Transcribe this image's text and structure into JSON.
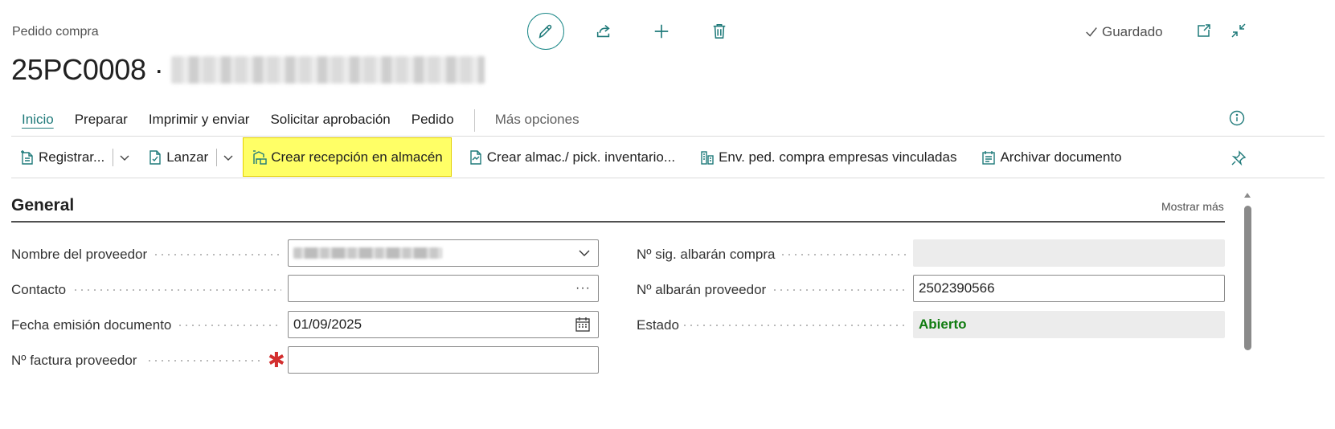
{
  "header": {
    "caption": "Pedido compra",
    "record_no": "25PC0008",
    "separator": "·",
    "saved_label": "Guardado"
  },
  "top_actions": {
    "edit_icon": "pencil-icon",
    "share_icon": "share-icon",
    "new_icon": "plus-icon",
    "delete_icon": "trash-icon"
  },
  "tabs": [
    {
      "label": "Inicio",
      "active": true
    },
    {
      "label": "Preparar"
    },
    {
      "label": "Imprimir y enviar"
    },
    {
      "label": "Solicitar aprobación"
    },
    {
      "label": "Pedido"
    },
    {
      "label": "Más opciones"
    }
  ],
  "toolbar": {
    "post_label": "Registrar...",
    "release_label": "Lanzar",
    "create_receipt_label": "Crear recepción en almacén",
    "create_pick_label": "Crear almac./ pick. inventario...",
    "send_intercompany_label": "Env. ped. compra empresas vinculadas",
    "archive_label": "Archivar documento"
  },
  "general": {
    "title": "General",
    "show_more": "Mostrar más",
    "left_fields": [
      {
        "label": "Nombre del proveedor",
        "value": ""
      },
      {
        "label": "Contacto",
        "value": ""
      },
      {
        "label": "Fecha emisión documento",
        "value": "01/09/2025"
      },
      {
        "label": "Nº factura proveedor",
        "value": ""
      }
    ],
    "right_fields": [
      {
        "label": "Nº sig. albarán compra",
        "value": ""
      },
      {
        "label": "Nº albarán proveedor",
        "value": "2502390566"
      },
      {
        "label": "Estado",
        "value": "Abierto"
      }
    ]
  },
  "colors": {
    "accent": "#1f7a7a",
    "highlight": "#ffff66",
    "status_open": "#107c10",
    "required": "#d32f2f"
  }
}
